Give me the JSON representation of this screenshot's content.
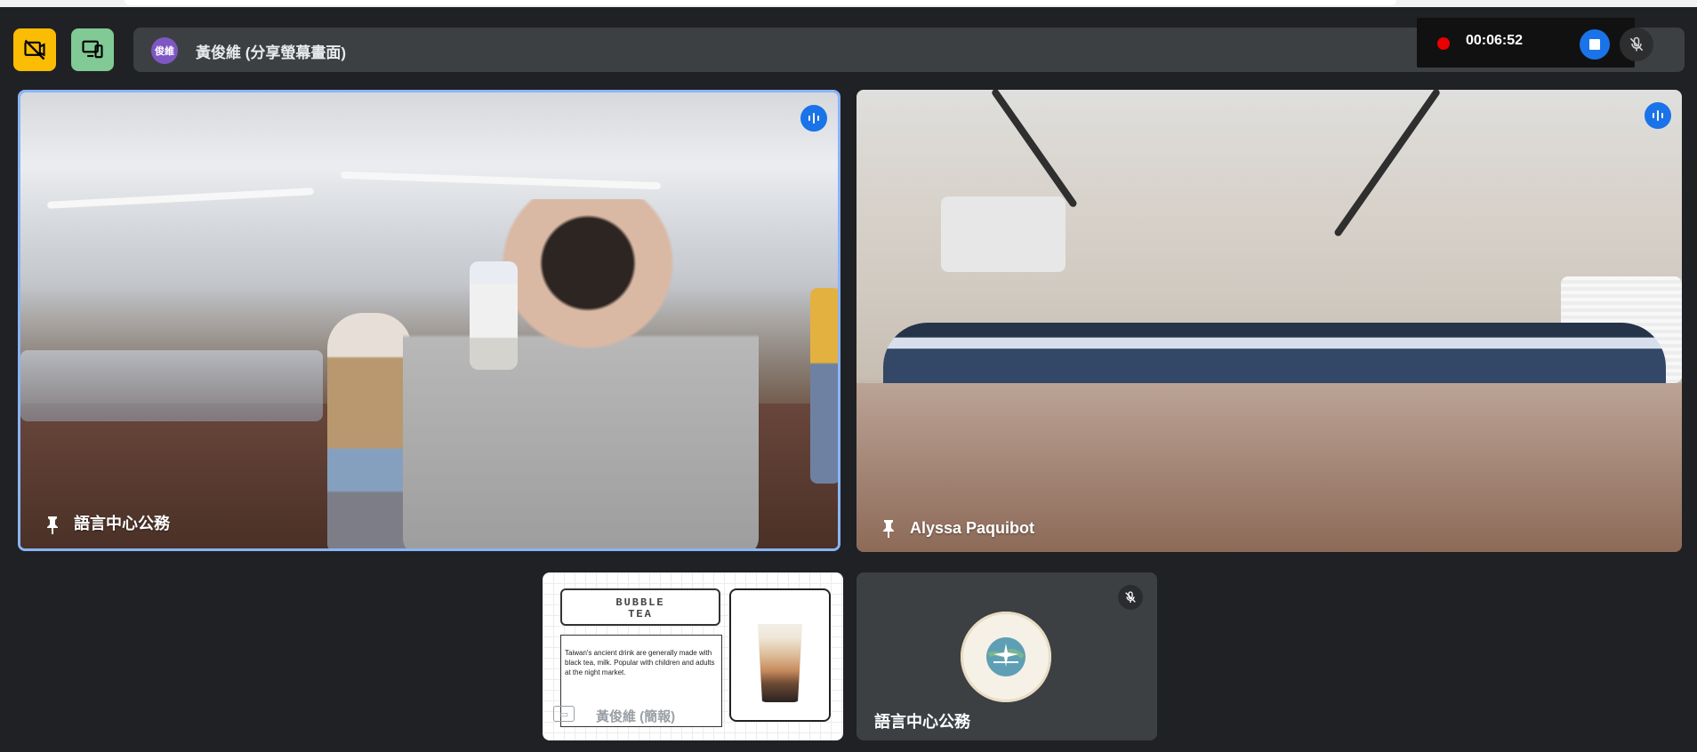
{
  "presenter": {
    "avatar_text": "俊維",
    "label": "黃俊維 (分享螢幕畫面)"
  },
  "recording": {
    "time": "00:06:52"
  },
  "tiles": {
    "left_name": "語言中心公務",
    "right_name": "Alyssa Paquibot",
    "audio_name": "語言中心公務"
  },
  "shared": {
    "title_line1": "BUBBLE",
    "title_line2": "TEA",
    "description": "Taiwan's ancient drink are generally made with black tea, milk. Popular with children and adults at the night market.",
    "presenter_name": "黃俊維 (簡報)"
  },
  "icons": {
    "camera_off": "camera-off-icon",
    "device": "devices-icon",
    "talking": "talking-icon",
    "pin": "pin-icon",
    "mic_off": "mic-off-icon"
  },
  "colors": {
    "meet_blue": "#1a73e8",
    "record_red": "#ea0000",
    "yellow": "#fbbc04",
    "green": "#81c995",
    "dark_bg": "#202124"
  }
}
